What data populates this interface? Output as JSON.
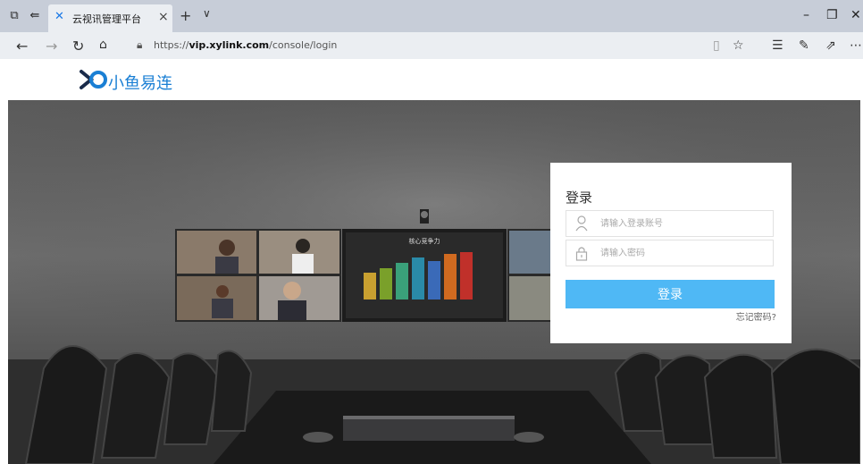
{
  "browser": {
    "tab_title": "云视讯管理平台",
    "url_prefix": "https://",
    "url_host": "vip.xylink.com",
    "url_path": "/console/login"
  },
  "header": {
    "brand": "小鱼易连"
  },
  "login": {
    "title": "登录",
    "account_placeholder": "请输入登录账号",
    "password_placeholder": "请输入密码",
    "submit_label": "登录",
    "forgot_label": "忘记密码?"
  },
  "hero": {
    "screen_title": "核心竞争力"
  },
  "colors": {
    "accent": "#4fb8f5",
    "brand": "#1a7fd4",
    "tabbar": "#c7cdd8"
  }
}
